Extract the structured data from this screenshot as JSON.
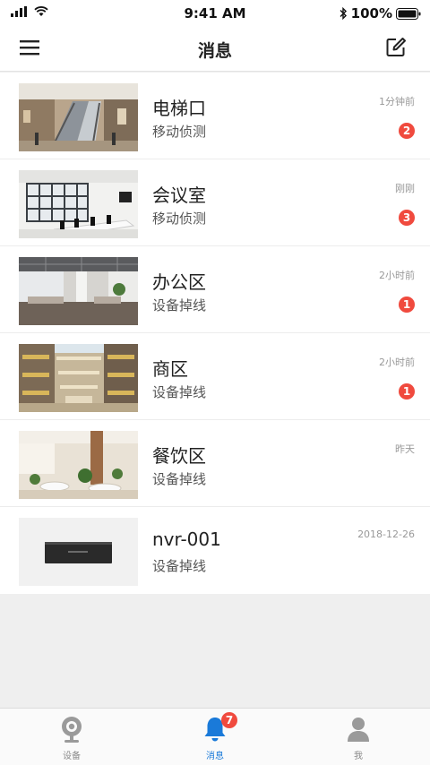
{
  "status_bar": {
    "time": "9:41 AM",
    "battery_text": "100%"
  },
  "nav": {
    "title": "消息",
    "left_icon": "menu-icon",
    "right_icon": "edit-icon"
  },
  "messages": [
    {
      "title": "电梯口",
      "subtitle": "移动侦测",
      "time": "1分钟前",
      "badge": "2",
      "thumb": "escalator"
    },
    {
      "title": "会议室",
      "subtitle": "移动侦测",
      "time": "刚刚",
      "badge": "3",
      "thumb": "meeting-room"
    },
    {
      "title": "办公区",
      "subtitle": "设备掉线",
      "time": "2小时前",
      "badge": "1",
      "thumb": "office"
    },
    {
      "title": "商区",
      "subtitle": "设备掉线",
      "time": "2小时前",
      "badge": "1",
      "thumb": "mall"
    },
    {
      "title": "餐饮区",
      "subtitle": "设备掉线",
      "time": "昨天",
      "badge": "",
      "thumb": "restaurant"
    },
    {
      "title": "nvr-001",
      "subtitle": "设备掉线",
      "time": "2018-12-26",
      "badge": "",
      "thumb": "nvr-device"
    }
  ],
  "tabs": [
    {
      "label": "设备",
      "icon": "camera-icon",
      "active": false,
      "badge": ""
    },
    {
      "label": "消息",
      "icon": "bell-icon",
      "active": true,
      "badge": "7"
    },
    {
      "label": "我",
      "icon": "person-icon",
      "active": false,
      "badge": ""
    }
  ],
  "colors": {
    "accent": "#1a7ad9",
    "badge": "#f04a3e",
    "background": "#efefef"
  }
}
